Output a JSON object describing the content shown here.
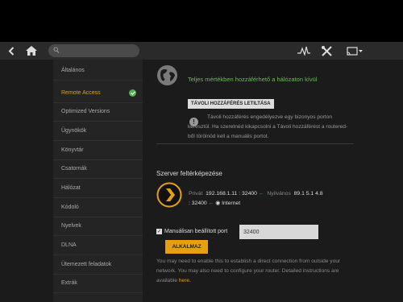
{
  "search": {
    "placeholder": ""
  },
  "sidebar": {
    "items": [
      {
        "label": "Általános"
      },
      {
        "label": "Remote Access"
      },
      {
        "label": "Optimized Versions"
      },
      {
        "label": "Ügynökök"
      },
      {
        "label": "Könyvtár"
      },
      {
        "label": "Csatornák"
      },
      {
        "label": "Hálózat"
      },
      {
        "label": "Kódoló"
      },
      {
        "label": "Nyelvek"
      },
      {
        "label": "DLNA"
      },
      {
        "label": "Ütemezett feladatok"
      },
      {
        "label": "Extrák"
      }
    ],
    "active_index": 1
  },
  "main": {
    "status_text": "Teljes mértékben hozzáférhető a hálózaton kívül",
    "disable_button": "TÁVOLI HOZZÁFÉRÉS LETILTÁSA",
    "warning_text": "Távoli hozzáférés engedélyezve egy bizonyos porton keresztül. Ha szeretnéd kikapcsolni a Távoli hozzáférést a routered-ből törölnöd kell a manuális portot.",
    "server_section_title": "Szerver feltérképezése",
    "private_label": "Privát",
    "private_ip": "192.168.1.11",
    "private_port": "32400",
    "public_label": "Nyilvános",
    "public_ip": "89.1  5.1  4.8",
    "public_port": "32400",
    "internet_label": "Internet",
    "manual_port_label": "Manuálisan beállított port",
    "manual_port_checked": true,
    "manual_port_value": "32400",
    "apply_button": "ALKALMAZ",
    "help_text": "You may need to enable this to establish a direct connection from outside your network. You may also need to configure your router. Detailed instructions are available",
    "help_link": "here."
  },
  "colors": {
    "accent": "#e5a00d",
    "success": "#4eb34b",
    "status_text": "#6fb85b"
  }
}
